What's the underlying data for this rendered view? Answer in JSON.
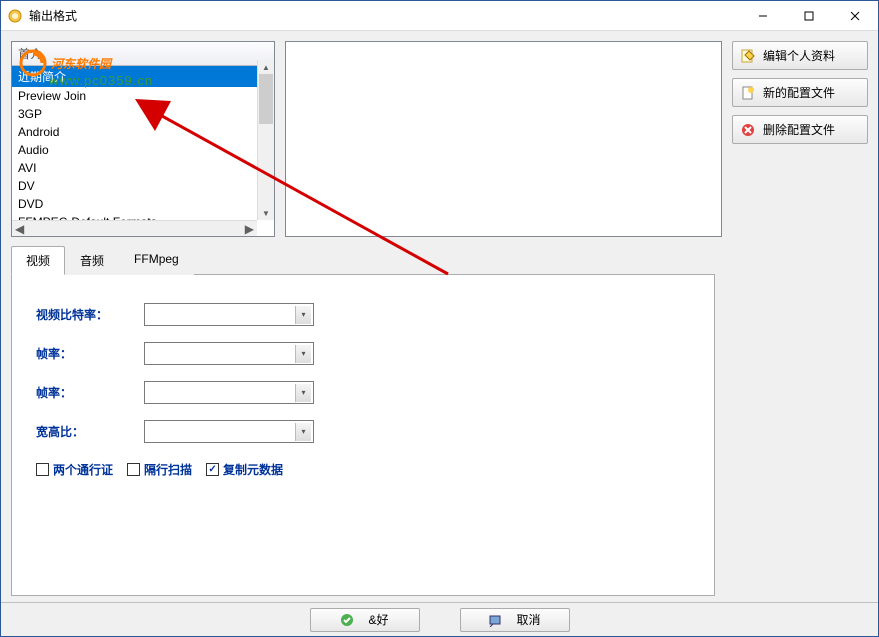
{
  "window": {
    "title": "输出格式"
  },
  "watermark": {
    "main": "河东软件园",
    "sub": "www.pc0359.cn"
  },
  "list": {
    "header": "首介",
    "items": [
      "近期简介",
      "Preview Join",
      "3GP",
      "Android",
      "Audio",
      "AVI",
      "DV",
      "DVD",
      "FFMPEG Default Formats"
    ],
    "selected_index": 0
  },
  "side_buttons": {
    "edit": "编辑个人资料",
    "new": "新的配置文件",
    "delete": "删除配置文件"
  },
  "tabs": {
    "video": "视频",
    "audio": "音频",
    "ffmpeg": "FFMpeg",
    "active": 0
  },
  "form": {
    "video_bitrate_label": "视频比特率：",
    "video_bitrate_value": "",
    "framerate1_label": "帧率：",
    "framerate1_value": "",
    "framerate2_label": "帧率：",
    "framerate2_value": "",
    "aspect_label": "宽高比：",
    "aspect_value": ""
  },
  "checks": {
    "two_pass": "两个通行证",
    "interlace": "隔行扫描",
    "copy_meta": "复制元数据",
    "two_pass_checked": false,
    "interlace_checked": false,
    "copy_meta_checked": true
  },
  "bottom": {
    "ok": "&好",
    "cancel": "取消"
  }
}
